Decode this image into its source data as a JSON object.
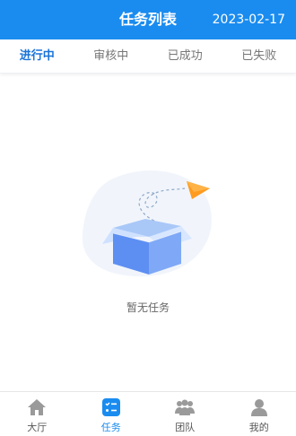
{
  "header": {
    "title": "任务列表",
    "date": "2023-02-17",
    "color": "#1a8cf0"
  },
  "tabs": [
    {
      "label": "进行中",
      "active": true
    },
    {
      "label": "审核中",
      "active": false
    },
    {
      "label": "已成功",
      "active": false
    },
    {
      "label": "已失败",
      "active": false
    }
  ],
  "empty_state": {
    "message": "暂无任务",
    "illustration": "open-box-paper-plane"
  },
  "bottom_nav": [
    {
      "label": "大厅",
      "icon": "home-icon",
      "active": false
    },
    {
      "label": "任务",
      "icon": "task-list-icon",
      "active": true
    },
    {
      "label": "团队",
      "icon": "team-icon",
      "active": false
    },
    {
      "label": "我的",
      "icon": "user-icon",
      "active": false
    }
  ]
}
